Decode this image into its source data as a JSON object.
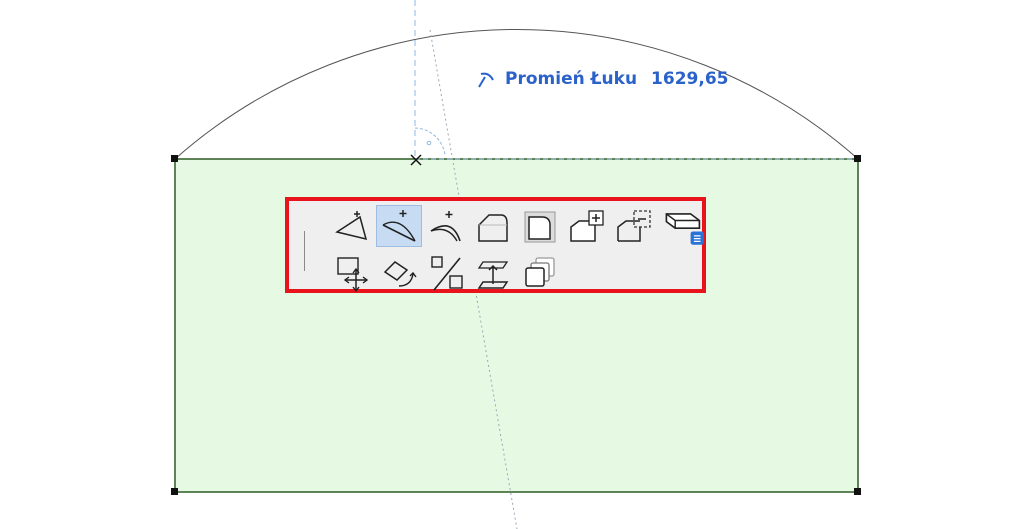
{
  "readout": {
    "label": "Promień Łuku",
    "value": "1629,65",
    "icon": "radius-icon",
    "color": "#2b62c9"
  },
  "colors": {
    "fill_area": "#e6fae3",
    "outline": "#2d5a23",
    "arc": "#555555",
    "guide": "#8fb8e0",
    "highlight_border": "#e8131b",
    "toolbar_bg": "#efefef",
    "active_button": "#c7dcf3"
  },
  "pet_palette": {
    "rows": [
      [
        {
          "name": "offset-edge-icon",
          "active": false
        },
        {
          "name": "curve-edge-icon",
          "active": true
        },
        {
          "name": "arc-edge-icon",
          "active": false
        },
        {
          "name": "fillet-corner-icon",
          "active": false
        },
        {
          "name": "chamfer-corner-icon",
          "active": false
        },
        {
          "name": "add-polygon-icon",
          "active": false
        },
        {
          "name": "subtract-polygon-icon",
          "active": false
        },
        {
          "name": "elevate-slab-icon",
          "active": false
        }
      ],
      [
        {
          "name": "drag-move-icon",
          "active": false
        },
        {
          "name": "rotate-icon",
          "active": false
        },
        {
          "name": "resize-icon",
          "active": false
        },
        {
          "name": "elevate-icon",
          "active": false
        },
        {
          "name": "multiply-icon",
          "active": false
        }
      ]
    ]
  }
}
